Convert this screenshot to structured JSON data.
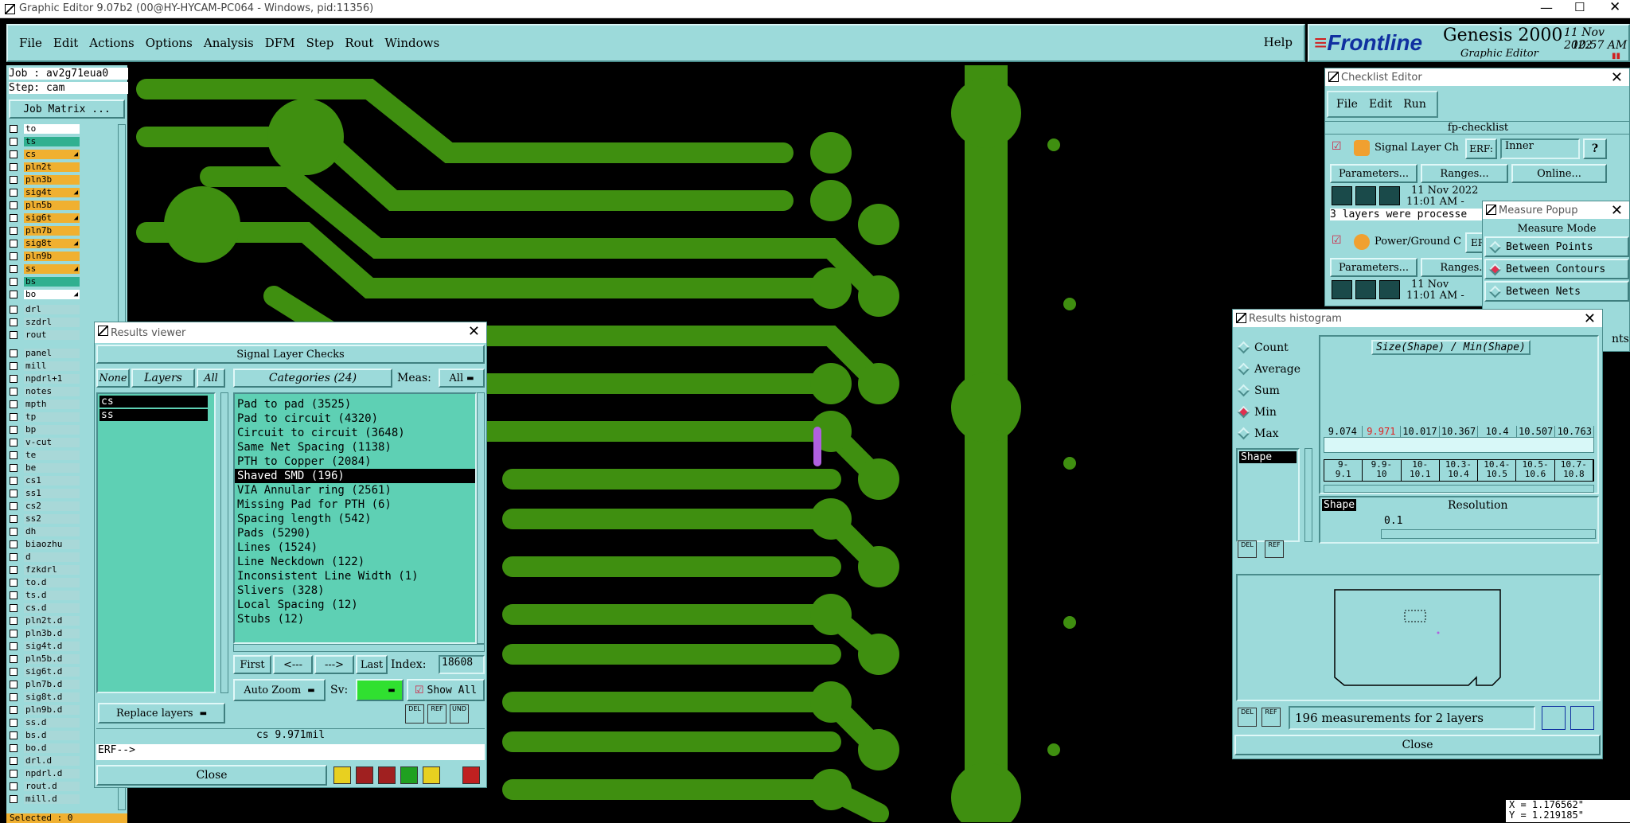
{
  "window": {
    "title": "Graphic Editor 9.07b2 (00@HY-HYCAM-PC064 - Windows, pid:11356)"
  },
  "menu": {
    "items": [
      "File",
      "Edit",
      "Actions",
      "Options",
      "Analysis",
      "DFM",
      "Step",
      "Rout",
      "Windows"
    ],
    "help": "Help"
  },
  "brand": {
    "logo": "Frontline",
    "product": "Genesis 2000",
    "subtitle": "Graphic Editor",
    "date": "11 Nov 2022",
    "time": "10:57 AM"
  },
  "job": {
    "job": "Job : av2g71eua0",
    "step": "Step: cam",
    "matrix": "Job Matrix ..."
  },
  "layers": [
    {
      "name": "to",
      "c": "w",
      "a": ""
    },
    {
      "name": "ts",
      "c": "g",
      "a": ""
    },
    {
      "name": "cs",
      "c": "o",
      "a": "a"
    },
    {
      "name": "pln2t",
      "c": "o",
      "a": ""
    },
    {
      "name": "pln3b",
      "c": "o",
      "a": ""
    },
    {
      "name": "sig4t",
      "c": "o",
      "a": "a"
    },
    {
      "name": "pln5b",
      "c": "o",
      "a": ""
    },
    {
      "name": "sig6t",
      "c": "o",
      "a": "a"
    },
    {
      "name": "pln7b",
      "c": "o",
      "a": ""
    },
    {
      "name": "sig8t",
      "c": "o",
      "a": "a"
    },
    {
      "name": "pln9b",
      "c": "o",
      "a": ""
    },
    {
      "name": "ss",
      "c": "o",
      "a": "a"
    },
    {
      "name": "bs",
      "c": "g",
      "a": ""
    },
    {
      "name": "bo",
      "c": "w",
      "a": "a"
    }
  ],
  "layers2": [
    "drl",
    "szdrl",
    "rout"
  ],
  "layers3": [
    "panel",
    "mill",
    "npdrl+1",
    "notes",
    "mpth",
    "tp",
    "bp",
    "v-cut",
    "te",
    "be",
    "cs1",
    "ss1",
    "cs2",
    "ss2",
    "dh",
    "biaozhu",
    "d",
    "fzkdrl",
    "to.d",
    "ts.d",
    "cs.d",
    "pln2t.d",
    "pln3b.d",
    "sig4t.d",
    "pln5b.d",
    "sig6t.d",
    "pln7b.d",
    "sig8t.d",
    "pln9b.d",
    "ss.d",
    "bs.d",
    "bo.d",
    "drl.d",
    "npdrl.d",
    "rout.d",
    "mill.d"
  ],
  "selected": "Selected : 0",
  "checklist": {
    "title": "Checklist Editor",
    "menu": [
      "File",
      "Edit",
      "Run"
    ],
    "name": "fp-checklist",
    "items": [
      {
        "name": "Signal Layer Ch",
        "erf": "ERF:",
        "erfval": "Inner",
        "date": "11 Nov 2022",
        "time": "11:01 AM -",
        "msg": "3 layers were processe"
      },
      {
        "name": "Power/Ground C",
        "erf": "ERF",
        "date": "11 Nov",
        "time": "11:01 AM -"
      }
    ],
    "params": "Parameters...",
    "ranges": "Ranges...",
    "online": "Online..."
  },
  "measure": {
    "title": "Measure Popup",
    "mode": "Measure Mode",
    "options": [
      "Between Points",
      "Between Contours",
      "Between Nets"
    ],
    "selected": 1,
    "extra": "nts"
  },
  "results": {
    "title": "Results viewer",
    "header": "Signal Layer Checks",
    "none": "None",
    "layers": "Layers",
    "all": "All",
    "categories_label": "Categories (24)",
    "meas_label": "Meas:",
    "meas_value": "All",
    "layer_list": [
      "cs",
      "ss"
    ],
    "categories": [
      "Pad to pad (3525)",
      "Pad to circuit (4320)",
      "Circuit to circuit (3648)",
      "Same Net Spacing (1138)",
      "PTH to Copper (2084)",
      "Shaved SMD (196)",
      "VIA Annular ring (2561)",
      "Missing Pad for PTH (6)",
      "Spacing length (542)",
      "Pads (5290)",
      "Lines (1524)",
      "Line Neckdown (122)",
      "Inconsistent Line Width (1)",
      "Slivers (328)",
      "Local Spacing (12)",
      "Stubs (12)"
    ],
    "selected_index": 5,
    "nav": {
      "first": "First",
      "prev": "<---",
      "next": "--->",
      "last": "Last",
      "index_label": "Index:",
      "index": "18608"
    },
    "autozoom": "Auto Zoom",
    "sv": "Sv:",
    "showall": "Show All",
    "replace": "Replace layers",
    "status": "cs 9.971mil",
    "erf": "ERF-->",
    "close": "Close"
  },
  "histogram": {
    "title": "Results histogram",
    "modes": [
      "Count",
      "Average",
      "Sum",
      "Min",
      "Max"
    ],
    "selected": 3,
    "formula": "Size(Shape) / Min(Shape)",
    "list_item": "Shape",
    "values": [
      "9.074",
      "9.971",
      "10.017",
      "10.367",
      "10.4",
      "10.507",
      "10.763"
    ],
    "value_colors": [
      "#000",
      "#e02020",
      "#000",
      "#000",
      "#000",
      "#000",
      "#000"
    ],
    "ranges": [
      [
        "9-",
        "9.1"
      ],
      [
        "9.9-",
        "10"
      ],
      [
        "10-",
        "10.1"
      ],
      [
        "10.3-",
        "10.4"
      ],
      [
        "10.4-",
        "10.5"
      ],
      [
        "10.5-",
        "10.6"
      ],
      [
        "10.7-",
        "10.8"
      ]
    ],
    "shape_label": "Shape",
    "resolution_label": "Resolution",
    "resolution": "0.1",
    "summary": "196 measurements for 2 layers",
    "close": "Close"
  },
  "coords": {
    "x": "X = 1.176562\"",
    "y": "Y = 1.219185\""
  },
  "colors": {
    "panel": "#9cdada",
    "title_bar": "#ffffff",
    "copper": "#3f8f10",
    "listbg": "#5ed0b4"
  }
}
